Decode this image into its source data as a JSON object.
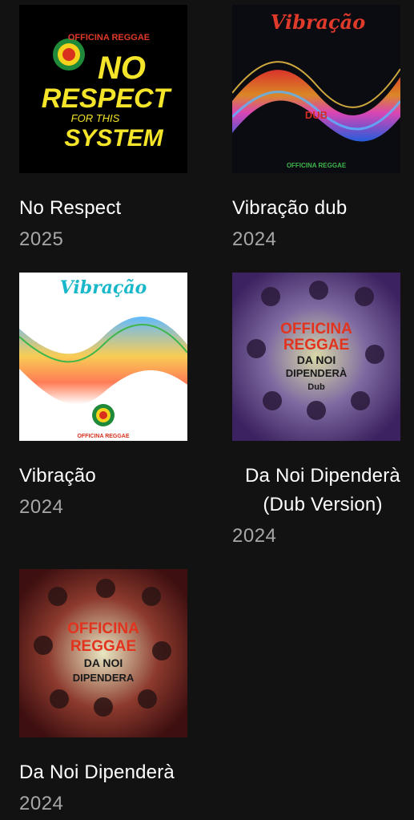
{
  "albums": [
    {
      "title": "No Respect",
      "year": "2025",
      "cover": {
        "badge": "OFFICINA REGGAE",
        "line1": "NO",
        "line2": "RESPECT",
        "line3": "FOR THIS",
        "line4": "SYSTEM",
        "colors": {
          "bg": "#000000",
          "text": "#f5e52a"
        }
      }
    },
    {
      "title": "Vibração dub",
      "year": "2024",
      "cover": {
        "heading": "Vibração",
        "center": "DUB",
        "footer": "OFFICINA REGGAE",
        "colors": {
          "bg": "#0b0b12",
          "heading": "#e03a2b",
          "footer": "#3fb64a"
        }
      }
    },
    {
      "title": "Vibração",
      "year": "2024",
      "cover": {
        "heading": "Vibração",
        "footer": "OFFICINA REGGAE",
        "colors": {
          "bg": "#ffffff",
          "heading": "#18b7c9"
        }
      }
    },
    {
      "title_line1": "Da Noi Dipenderà",
      "title_line2": "(Dub Version)",
      "year": "2024",
      "cover": {
        "line1": "OFFICINA",
        "line2": "REGGAE",
        "line3": "DA NOI",
        "line4": "DIPENDERÀ",
        "line5": "Dub",
        "colors": {
          "bg": "#4a2a6e",
          "title": "#e2331f"
        }
      }
    },
    {
      "title": "Da Noi Dipenderà",
      "year": "2024",
      "cover": {
        "line1": "OFFICINA",
        "line2": "REGGAE",
        "line3": "DA NOI",
        "line4": "DIPENDERA",
        "colors": {
          "bg": "#7a1a1a",
          "title": "#e2331f"
        }
      }
    }
  ]
}
